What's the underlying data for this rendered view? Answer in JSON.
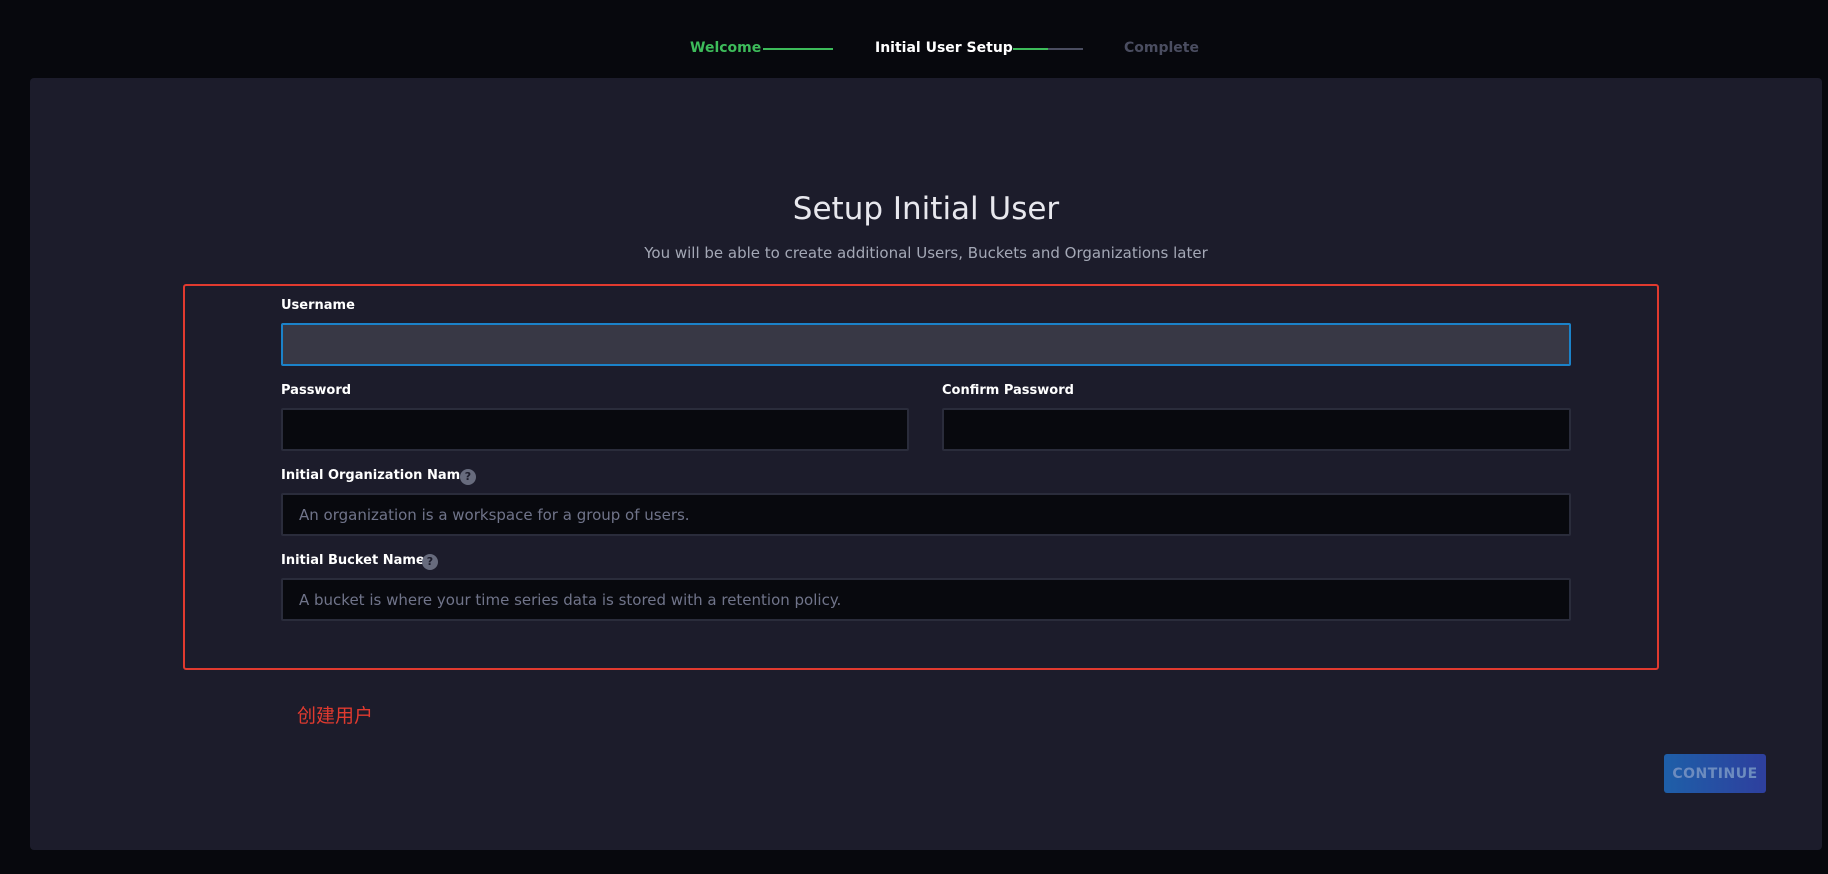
{
  "stepper": {
    "steps": [
      {
        "label": "Welcome",
        "state": "done"
      },
      {
        "label": "Initial User Setup",
        "state": "current"
      },
      {
        "label": "Complete",
        "state": "pending"
      }
    ]
  },
  "form": {
    "title": "Setup Initial User",
    "subtitle": "You will be able to create additional Users, Buckets and Organizations later",
    "username": {
      "label": "Username",
      "value": "",
      "placeholder": ""
    },
    "password": {
      "label": "Password",
      "value": "",
      "placeholder": ""
    },
    "confirm_password": {
      "label": "Confirm Password",
      "value": "",
      "placeholder": ""
    },
    "organization": {
      "label": "Initial Organization Name",
      "value": "",
      "placeholder": "An organization is a workspace for a group of users."
    },
    "bucket": {
      "label": "Initial Bucket Name",
      "value": "",
      "placeholder": "A bucket is where your time series data is stored with a retention policy."
    },
    "help_glyph": "?"
  },
  "annotation": {
    "text": "创建用户",
    "color": "#e03a2f"
  },
  "actions": {
    "continue_label": "CONTINUE"
  },
  "colors": {
    "success": "#3dbb5a",
    "focus": "#1b82c9",
    "highlight": "#e03a2f"
  }
}
